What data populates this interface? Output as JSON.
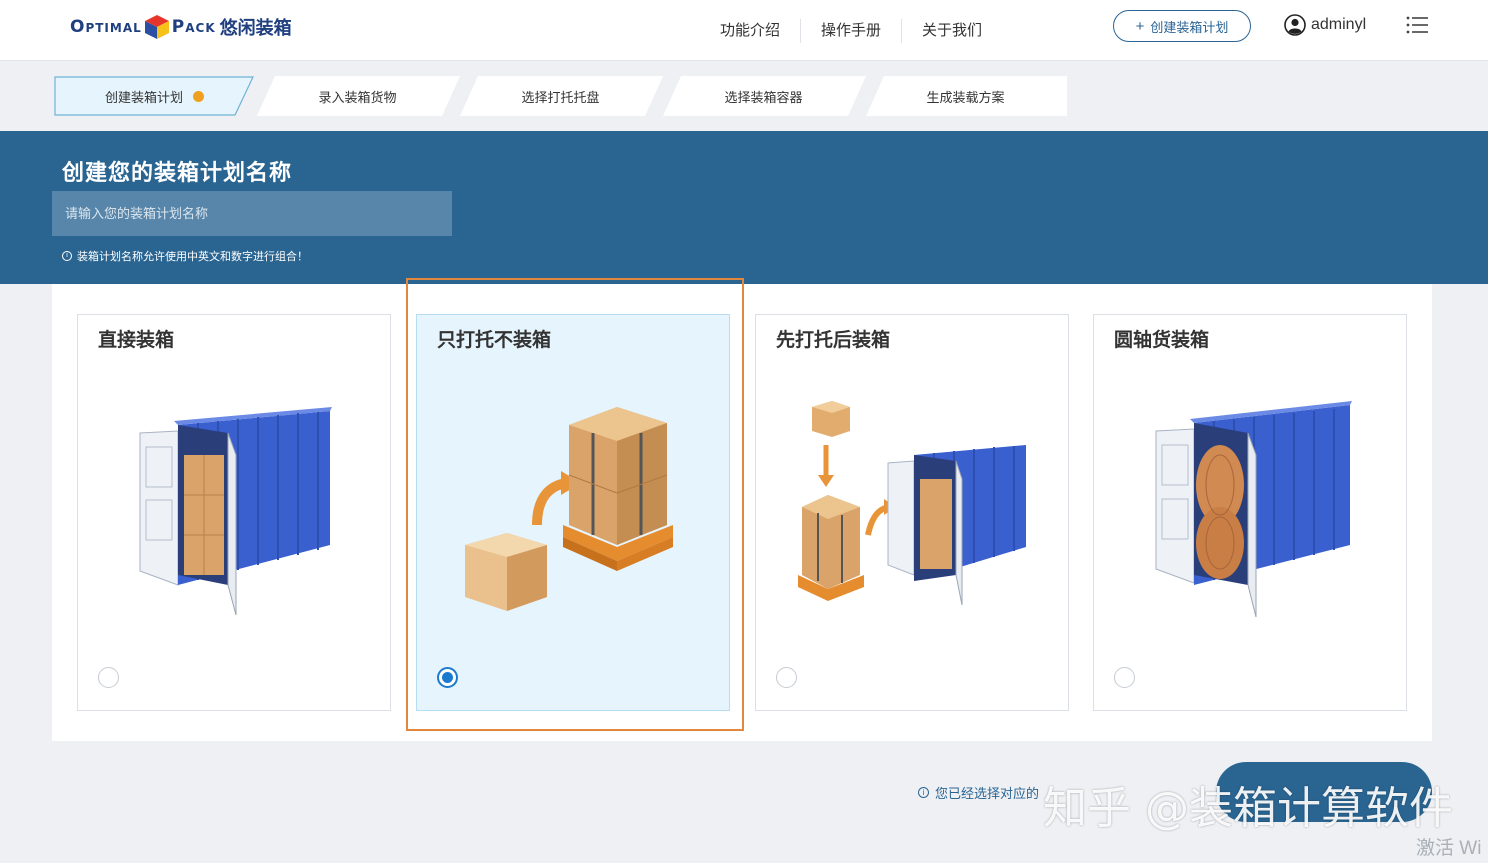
{
  "header": {
    "logo_word1": "Optimal",
    "logo_word2": "Pack",
    "logo_cn": "悠闲装箱",
    "nav": [
      "功能介绍",
      "操作手册",
      "关于我们"
    ],
    "create_plan_label": "创建装箱计划",
    "username": "adminyl"
  },
  "steps": [
    "创建装箱计划",
    "录入装箱货物",
    "选择打托托盘",
    "选择装箱容器",
    "生成装载方案"
  ],
  "banner": {
    "title": "创建您的装箱计划名称",
    "input_placeholder": "请输入您的装箱计划名称",
    "input_value": "",
    "hint": "装箱计划名称允许使用中英文和数字进行组合！"
  },
  "cards": [
    {
      "title": "直接装箱",
      "selected": false,
      "icon": "container-with-boxes-icon"
    },
    {
      "title": "只打托不装箱",
      "selected": true,
      "icon": "palletized-boxes-icon"
    },
    {
      "title": "先打托后装箱",
      "selected": false,
      "icon": "pallet-into-container-icon"
    },
    {
      "title": "圆轴货装箱",
      "selected": false,
      "icon": "container-with-rolls-icon"
    }
  ],
  "footer": {
    "hint": "您已经选择对应的",
    "watermark": "知乎 @装箱计算软件",
    "activate": "激活 Wi"
  },
  "colors": {
    "primary": "#2a6592",
    "accent": "#f0a020",
    "highlight": "#e2883e",
    "selected_bg": "#e6f4fd",
    "radio": "#1b7ad0"
  }
}
